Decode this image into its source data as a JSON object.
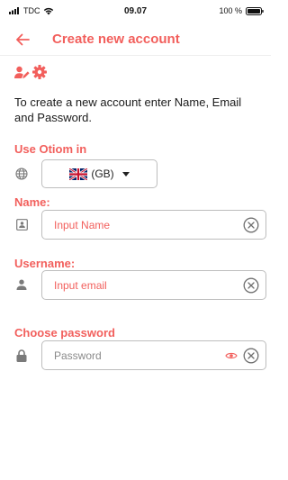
{
  "status_bar": {
    "carrier": "TDC",
    "time": "09.07",
    "battery": "100 %"
  },
  "header": {
    "title": "Create new account",
    "back_icon": "arrow-left-icon"
  },
  "colors": {
    "accent": "#f25f5c",
    "border": "#bdbdbd",
    "icon_grey": "#7a7a7a"
  },
  "logo": {
    "icons": [
      "user-edit-icon",
      "gear-icon"
    ]
  },
  "intro_text": "To create a new account enter Name, Email and Password.",
  "language": {
    "label": "Use Otiom in",
    "selected": "(GB)",
    "flag": "uk-flag-icon",
    "icon": "globe-icon"
  },
  "name_field": {
    "label": "Name:",
    "placeholder": "Input Name",
    "icon": "id-card-icon"
  },
  "username_field": {
    "label": "Username:",
    "placeholder": "Input email",
    "icon": "person-icon"
  },
  "password_field": {
    "label": "Choose password",
    "placeholder": "Password",
    "icon": "lock-icon"
  }
}
